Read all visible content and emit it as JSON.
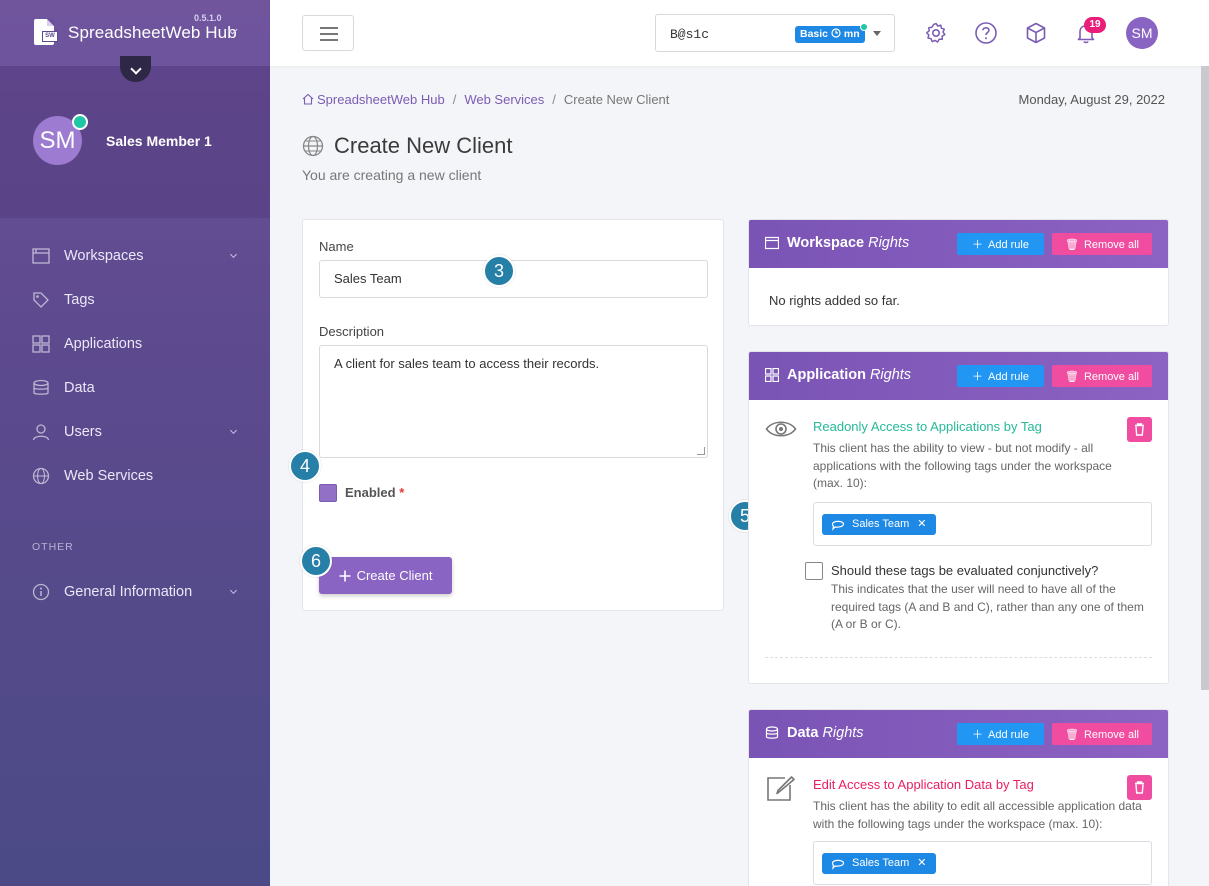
{
  "app": {
    "name": "SpreadsheetWeb Hub",
    "version": "0.5.1.0"
  },
  "user": {
    "name": "Sales Member 1",
    "initials": "SM"
  },
  "sidebar": {
    "items": [
      {
        "label": "Workspaces",
        "icon": "workspaces-icon",
        "has_chevron": true
      },
      {
        "label": "Tags",
        "icon": "tag-icon",
        "has_chevron": false
      },
      {
        "label": "Applications",
        "icon": "applications-icon",
        "has_chevron": false
      },
      {
        "label": "Data",
        "icon": "database-icon",
        "has_chevron": false
      },
      {
        "label": "Users",
        "icon": "user-icon",
        "has_chevron": true
      },
      {
        "label": "Web Services",
        "icon": "globe-icon",
        "has_chevron": false
      }
    ],
    "section_other": "OTHER",
    "general_info": "General Information"
  },
  "topbar": {
    "workspace_name": "B@s1c",
    "workspace_badge": "Basic",
    "workspace_badge_suffix": "mn",
    "notification_count": "19"
  },
  "breadcrumb": {
    "items": [
      "SpreadsheetWeb Hub",
      "Web Services",
      "Create New Client"
    ],
    "separator": "/"
  },
  "date": "Monday, August 29, 2022",
  "page": {
    "title": "Create New Client",
    "subtitle": "You are creating a new client"
  },
  "form": {
    "name_label": "Name",
    "name_value": "Sales Team",
    "description_label": "Description",
    "description_value": "A client for sales team to access their records.",
    "enabled_label": "Enabled",
    "required_mark": "*",
    "submit_label": "Create Client"
  },
  "steps": {
    "s3": "3",
    "s4": "4",
    "s5": "5",
    "s6": "6"
  },
  "buttons": {
    "add_rule": "Add rule",
    "remove_all": "Remove all"
  },
  "workspace_rights": {
    "title": "Workspace",
    "title_italic": "Rights",
    "empty": "No rights added so far."
  },
  "application_rights": {
    "title": "Application",
    "title_italic": "Rights",
    "rule_title": "Readonly Access to Applications by Tag",
    "rule_desc": "This client has the ability to view - but not modify - all applications with the following tags under the workspace (max. 10):",
    "tag": "Sales Team",
    "conj_label": "Should these tags be evaluated conjunctively?",
    "conj_desc": "This indicates that the user will need to have all of the required tags (A and B and C), rather than any one of them (A or B or C)."
  },
  "data_rights": {
    "title": "Data",
    "title_italic": "Rights",
    "rule_title": "Edit Access to Application Data by Tag",
    "rule_desc": "This client has the ability to edit all accessible application data with the following tags under the workspace (max. 10):",
    "tag": "Sales Team"
  },
  "colors": {
    "accent": "#8a64c2",
    "readonly_title": "#26b99a",
    "edit_title": "#e91e63",
    "add_button": "#2196f3",
    "remove_button": "#f04da0",
    "step_badge": "#257fa7"
  }
}
